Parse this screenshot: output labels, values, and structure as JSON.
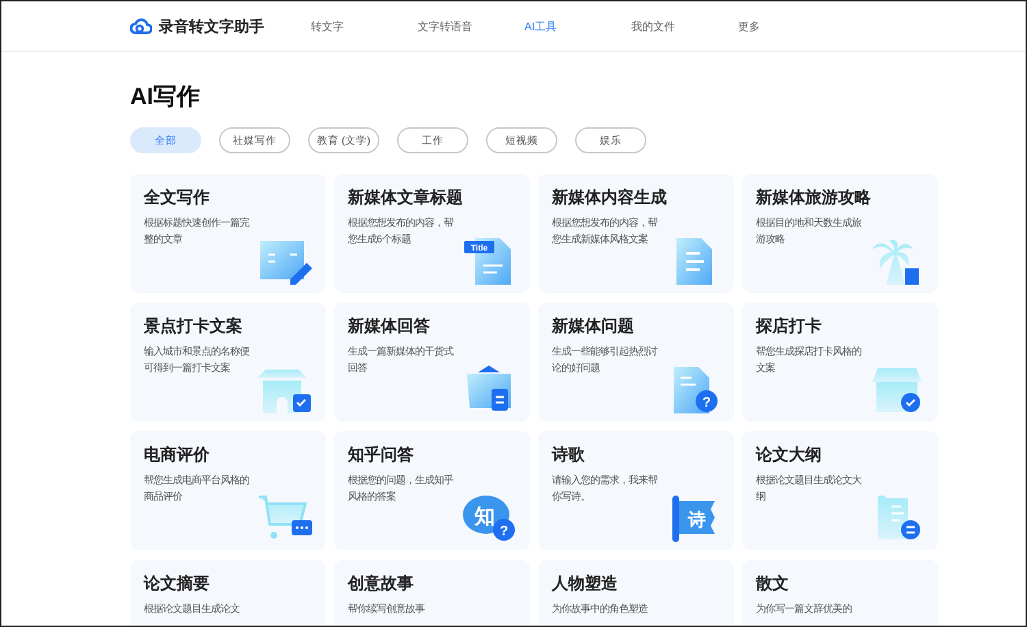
{
  "header": {
    "app_name": "录音转文字助手",
    "nav": [
      {
        "label": "转文字",
        "selected": false
      },
      {
        "label": "文字转语音",
        "selected": false
      },
      {
        "label": "AI工具",
        "selected": true
      },
      {
        "label": "我的文件",
        "selected": false
      },
      {
        "label": "更多",
        "selected": false
      }
    ]
  },
  "page_title": "AI写作",
  "filters": [
    {
      "label": "全部",
      "selected": true
    },
    {
      "label": "社媒写作",
      "selected": false
    },
    {
      "label": "教育 (文学)",
      "selected": false
    },
    {
      "label": "工作",
      "selected": false
    },
    {
      "label": "短视频",
      "selected": false
    },
    {
      "label": "娱乐",
      "selected": false
    }
  ],
  "cards": [
    {
      "title": "全文写作",
      "desc": "根据标题快速创作一篇完整的文章",
      "kind": "book"
    },
    {
      "title": "新媒体文章标题",
      "desc": "根据您想发布的内容，帮您生成6个标题",
      "kind": "title",
      "icon_text": "Title"
    },
    {
      "title": "新媒体内容生成",
      "desc": "根据您想发布的内容，帮您生成新媒体风格文案",
      "kind": "doc"
    },
    {
      "title": "新媒体旅游攻略",
      "desc": "根据目的地和天数生成旅游攻略",
      "kind": "palm"
    },
    {
      "title": "景点打卡文案",
      "desc": "输入城市和景点的名称便可得到一篇打卡文案",
      "kind": "gate"
    },
    {
      "title": "新媒体回答",
      "desc": "生成一篇新媒体的干货式回答",
      "kind": "box"
    },
    {
      "title": "新媒体问题",
      "desc": "生成一些能够引起热烈讨论的好问题",
      "kind": "question",
      "icon_text": "?"
    },
    {
      "title": "探店打卡",
      "desc": "帮您生成探店打卡风格的文案",
      "kind": "shop"
    },
    {
      "title": "电商评价",
      "desc": "帮您生成电商平台风格的商品评价",
      "kind": "cart"
    },
    {
      "title": "知乎问答",
      "desc": "根据您的问题，生成知乎风格的答案",
      "kind": "bubble",
      "icon_text": "知",
      "badge_text": "?"
    },
    {
      "title": "诗歌",
      "desc": "请输入您的需求，我来帮你写诗。",
      "kind": "scroll",
      "icon_text": "诗"
    },
    {
      "title": "论文大纲",
      "desc": "根据论文题目生成论文大纲",
      "kind": "outline"
    },
    {
      "title": "论文摘要",
      "desc": "根据论文题目生成论文"
    },
    {
      "title": "创意故事",
      "desc": "帮你续写创意故事"
    },
    {
      "title": "人物塑造",
      "desc": "为你故事中的角色塑造"
    },
    {
      "title": "散文",
      "desc": "为你写一篇文辞优美的"
    }
  ]
}
